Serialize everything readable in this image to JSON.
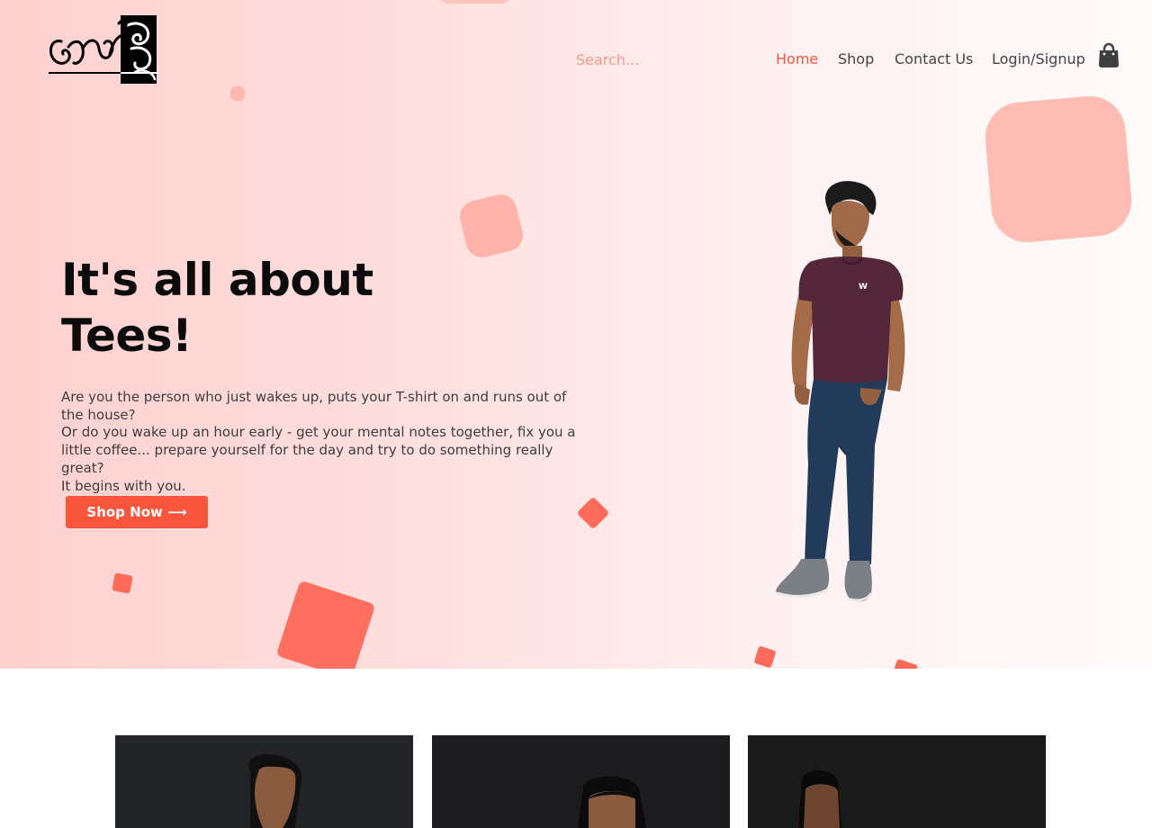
{
  "header": {
    "logo_alt": "Sinhala brand logo",
    "search": {
      "placeholder": "Search...",
      "value": ""
    },
    "nav": [
      {
        "label": "Home",
        "active": true
      },
      {
        "label": "Shop",
        "active": false
      },
      {
        "label": "Contact Us",
        "active": false
      },
      {
        "label": "Login/Signup",
        "active": false
      }
    ],
    "cart_icon": "shopping-bag-icon"
  },
  "hero": {
    "title_line1": "It's all about",
    "title_line2": "Tees!",
    "paragraph_lines": [
      "Are you the person who just wakes up, puts your T-shirt on and runs out of the house?",
      "Or do you wake up an hour early - get your mental notes together, fix you a little coffee... prepare yourself for the day and try to do something really great?",
      "It begins with you."
    ],
    "cta_label": "Shop Now ⟶",
    "image": "man-in-maroon-tshirt-and-jeans"
  },
  "products": [
    {
      "image": "man-black-background"
    },
    {
      "image": "woman-black-background"
    },
    {
      "image": "man-black-background-2"
    }
  ],
  "colors": {
    "accent": "#f9553c",
    "nav_active": "#f25a3e",
    "hero_gradient_start": "#ffd1cf",
    "hero_gradient_end": "#fffafa",
    "shape_salmon": "#ffb6ae",
    "shape_coral": "#ff7060"
  }
}
